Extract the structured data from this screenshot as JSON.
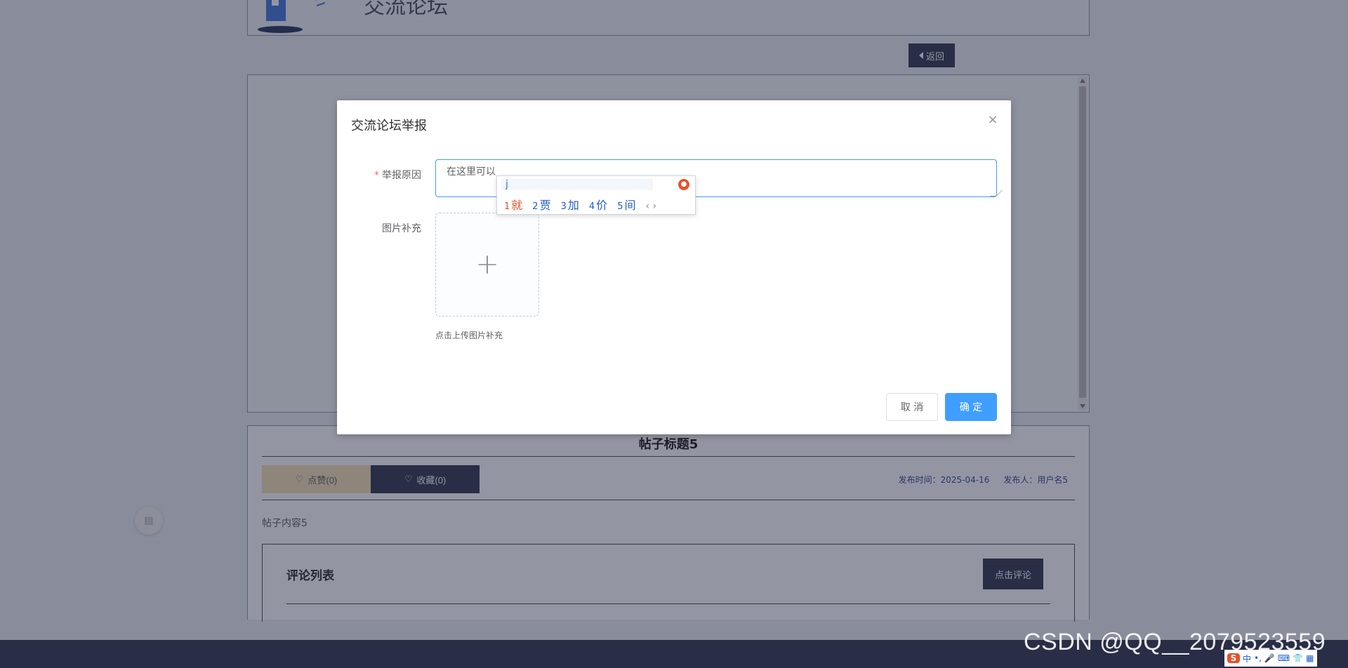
{
  "page": {
    "header_title": "交流论坛",
    "back_label": "返回",
    "post": {
      "title": "帖子标题5",
      "like_label": "点赞(0)",
      "favorite_label": "收藏(0)",
      "publish_time": "发布时间：2025-04-16",
      "publisher": "发布人：用户名5",
      "content": "帖子内容5"
    },
    "comments": {
      "title": "评论列表",
      "add_label": "点击评论"
    }
  },
  "dialog": {
    "title": "交流论坛举报",
    "reason_label": "举报原因",
    "reason_value": "在这里可以",
    "image_label": "图片补充",
    "upload_tip": "点击上传图片补充",
    "cancel_label": "取 消",
    "confirm_label": "确 定"
  },
  "ime": {
    "pinyin": "j",
    "candidates": [
      {
        "num": "1",
        "text": "就"
      },
      {
        "num": "2",
        "text": "贾"
      },
      {
        "num": "3",
        "text": "加"
      },
      {
        "num": "4",
        "text": "价"
      },
      {
        "num": "5",
        "text": "间"
      }
    ],
    "arrows": "‹ ›"
  },
  "watermark": "CSDN @QQ__2079523559",
  "tray": {
    "ime_mode": "中"
  },
  "colors": {
    "primary": "#409eff",
    "dark": "#2b2d45",
    "required": "#f56c6c",
    "like_bg": "#f5dfb0"
  }
}
